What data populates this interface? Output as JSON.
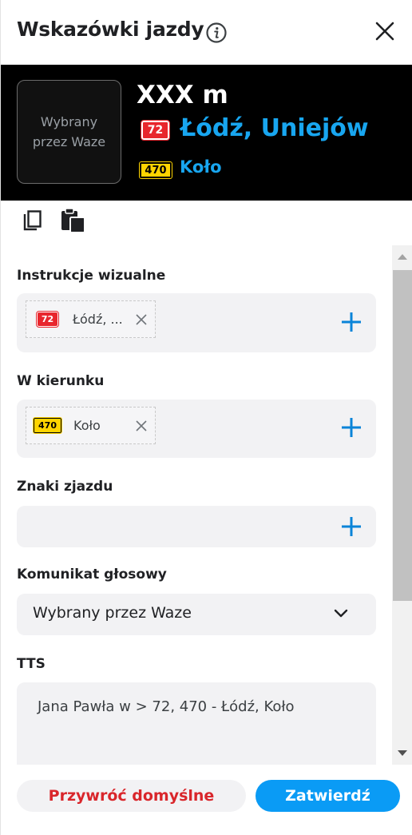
{
  "header": {
    "title": "Wskazówki jazdy",
    "info_icon": "info-icon",
    "close_icon": "close-icon"
  },
  "preview": {
    "image_placeholder": "Wybrany przez Waze",
    "distance": "XXX m",
    "primary_shield": "72",
    "primary_destination": "Łódź, Uniejów",
    "secondary_shield": "470",
    "secondary_destination": "Koło"
  },
  "toolbar": {
    "copy_icon": "copy-icon",
    "paste_icon": "paste-icon"
  },
  "form": {
    "visual_instructions": {
      "label": "Instrukcje wizualne",
      "chip_shield": "72",
      "chip_text": "Łódź, ..."
    },
    "towards": {
      "label": "W kierunku",
      "chip_shield": "470",
      "chip_text": "Koło"
    },
    "exit_signs": {
      "label": "Znaki zjazdu"
    },
    "voice_prompt": {
      "label": "Komunikat głosowy",
      "selected": "Wybrany przez Waze"
    },
    "tts": {
      "label": "TTS",
      "value": "Jana Pawła w > 72, 470 - Łódź, Koło"
    }
  },
  "footer": {
    "reset_label": "Przywróć domyślne",
    "confirm_label": "Zatwierdź"
  },
  "colors": {
    "accent_blue": "#0a9bf5",
    "destination_blue": "#18a6f0",
    "shield_red": "#e8262d",
    "shield_yellow": "#ffd400",
    "danger_red": "#d9262b"
  }
}
